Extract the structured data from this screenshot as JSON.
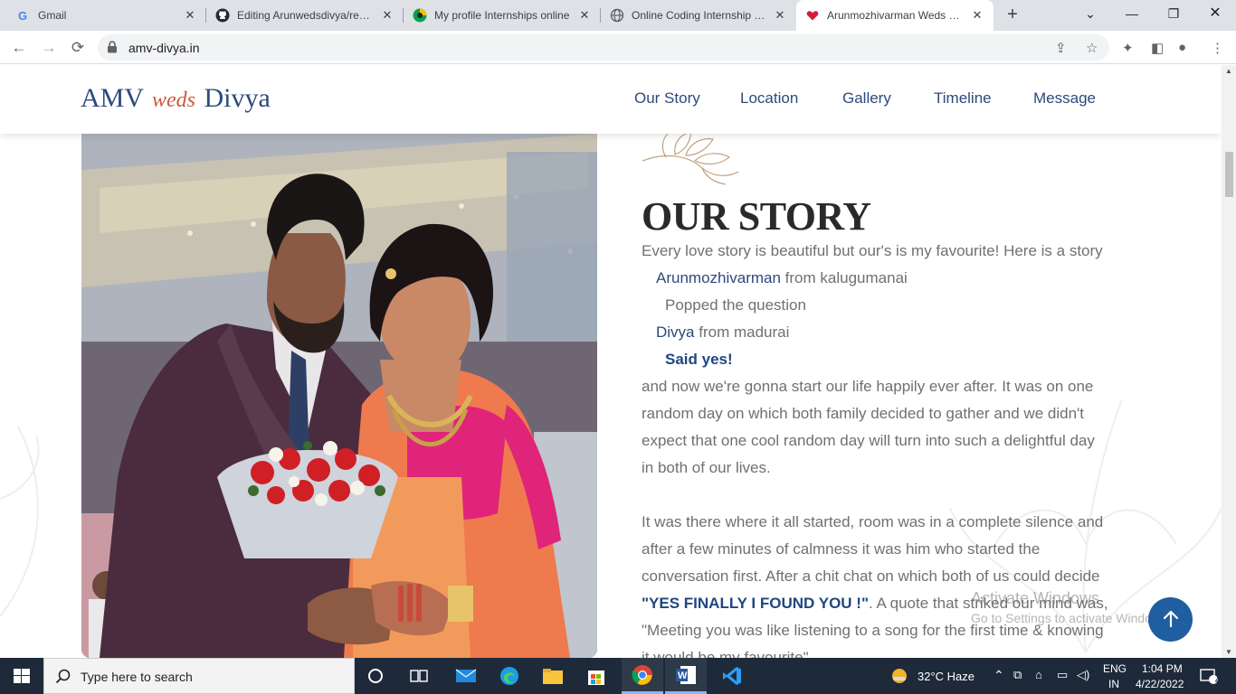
{
  "browser": {
    "tabs": [
      {
        "title": "Gmail",
        "favicon": "gmail-favicon"
      },
      {
        "title": "Editing Arunwedsdivya/readme",
        "favicon": "github-favicon"
      },
      {
        "title": "My profile Internships online",
        "favicon": "internshala-favicon"
      },
      {
        "title": "Online Coding Internship - Sk",
        "favicon": "globe-favicon"
      },
      {
        "title": "Arunmozhivarman Weds Divya",
        "favicon": "heart-favicon",
        "active": true
      }
    ],
    "url": "amv-divya.in"
  },
  "site": {
    "logo": {
      "left": "AMV",
      "middle": "weds",
      "right": "Divya"
    },
    "nav": [
      "Our Story",
      "Location",
      "Gallery",
      "Timeline",
      "Message"
    ]
  },
  "story": {
    "heading": "OUR STORY",
    "intro": "Every love story is beautiful but our's is my favourite! Here is a story",
    "groom_name": "Arunmozhivarman",
    "groom_from": " from kalugumanai",
    "popped": "Popped the question",
    "bride_name": "Divya",
    "bride_from": " from madurai",
    "said_yes": "Said yes!",
    "para1": [
      "and now we're gonna start our life happily ever after. It was on one",
      "random day on which both family decided to gather and we didn't",
      "expect that one cool random day will turn into such a delightful day",
      "in both of our lives."
    ],
    "para2": [
      "It was there where it all started, room was in a complete silence and",
      "after a few minutes of calmness it was him who started the",
      "conversation first. After a chit chat on which both of us could decide"
    ],
    "quote_bold": "\"YES FINALLY I FOUND YOU !\"",
    "quote_rest": ". A quote that striked our mind was,",
    "line_meeting": "\"Meeting you was like listening to a song for the first time & knowing",
    "line_partial": "it would be my favourite\""
  },
  "watermark": {
    "title": "Activate Windows",
    "subtitle": "Go to Settings to activate Windows."
  },
  "taskbar": {
    "search_placeholder": "Type here to search",
    "weather": "32°C  Haze",
    "lang_top": "ENG",
    "lang_bottom": "IN",
    "time": "1:04 PM",
    "date": "4/22/2022",
    "notifications": "4"
  },
  "colors": {
    "brand_blue": "#2c4a7c",
    "weds_accent": "#d0573c",
    "up_button": "#1f5ea0"
  }
}
